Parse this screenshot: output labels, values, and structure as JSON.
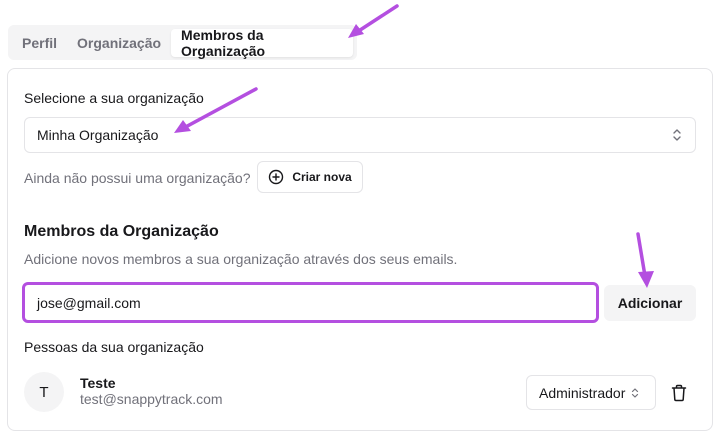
{
  "tabs": [
    {
      "label": "Perfil"
    },
    {
      "label": "Organização"
    },
    {
      "label": "Membros da Organização"
    }
  ],
  "org_select": {
    "label": "Selecione a sua organização",
    "value": "Minha Organização"
  },
  "no_org": {
    "text": "Ainda não possui uma organização?",
    "create_label": "Criar nova"
  },
  "members": {
    "title": "Membros da Organização",
    "description": "Adicione novos membros a sua organização através dos seus emails.",
    "email_value": "jose@gmail.com",
    "add_label": "Adicionar",
    "people_label": "Pessoas da sua organização",
    "list": [
      {
        "initial": "T",
        "name": "Teste",
        "email": "test@snappytrack.com",
        "role": "Administrador"
      }
    ]
  },
  "colors": {
    "accent": "#b44fe0",
    "annotation_arrow": "#b44fe0"
  }
}
